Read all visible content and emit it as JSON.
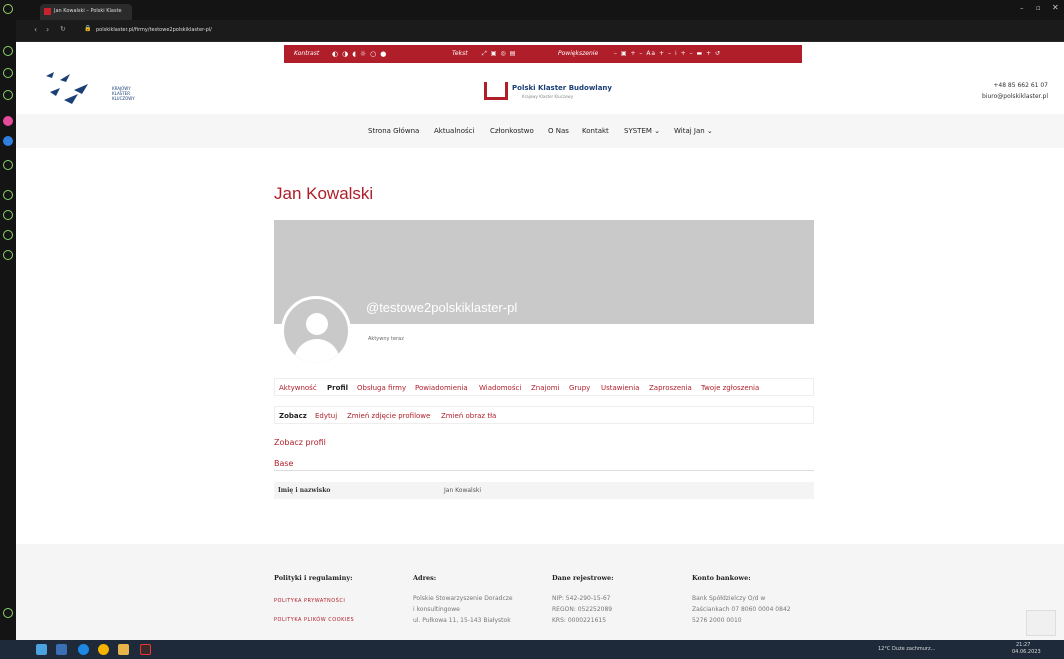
{
  "browser": {
    "tab_title": "Jan Kowalski – Polski Klaste",
    "url": "polskiklaster.pl/firmy/testowe2polskiklaster-pl/"
  },
  "accessibility_bar": {
    "contrast_label": "Kontrast",
    "text_label": "Tekst",
    "zoom_label": "Powiększenie"
  },
  "header": {
    "left_logo_text": [
      "KRAJOWY",
      "KLASTER",
      "KLUCZOWY"
    ],
    "brand_title": "Polski Klaster Budowlany",
    "brand_subtitle": "Krajowy Klaster Kluczowy",
    "phone": "+48 85 662 61 07",
    "email": "biuro@polskiklaster.pl"
  },
  "nav": {
    "items": [
      "Strona Główna",
      "Aktualności",
      "Członkostwo",
      "O Nas",
      "Kontakt",
      "SYSTEM ⌄",
      "Witaj Jan ⌄"
    ]
  },
  "profile": {
    "name": "Jan Kowalski",
    "handle": "@testowe2polskiklaster-pl",
    "status": "Aktywny teraz"
  },
  "main_tabs": [
    "Aktywność",
    "Profil",
    "Obsługa firmy",
    "Powiadomienia",
    "Wiadomości",
    "Znajomi",
    "Grupy",
    "Ustawienia",
    "Zaproszenia",
    "Twoje zgłoszenia"
  ],
  "sub_tabs": [
    "Zobacz",
    "Edytuj",
    "Zmień zdjęcie profilowe",
    "Zmień obraz tła"
  ],
  "view_profile": {
    "title": "Zobacz profil",
    "group": "Base",
    "field_label": "Imię i nazwisko",
    "field_value": "Jan Kowalski"
  },
  "footer": {
    "col1": {
      "head": "Polityki i regulaminy:",
      "links": [
        "POLITYKA PRYWATNOŚCI",
        "POLITYKA PLIKÓW COOKIES"
      ]
    },
    "col2": {
      "head": "Adres:",
      "lines": [
        "Polskie Stowarzyszenie Doradcze",
        "i konsultingowe",
        "ul. Pułkowa 11, 15-143 Białystok"
      ]
    },
    "col3": {
      "head": "Dane rejestrowe:",
      "lines": [
        "NIP: 542-290-15-67",
        "REGON: 052252089",
        "KRS: 0000221615"
      ]
    },
    "col4": {
      "head": "Konto bankowe:",
      "lines": [
        "Bank Spółdzielczy O/d w",
        "Zaściankach 07 8060 0004 0842",
        "5276 2000 0010"
      ]
    }
  },
  "taskbar": {
    "weather": "12°C Duże zachmurz...",
    "time": "21:27",
    "date": "04.06.2023"
  }
}
